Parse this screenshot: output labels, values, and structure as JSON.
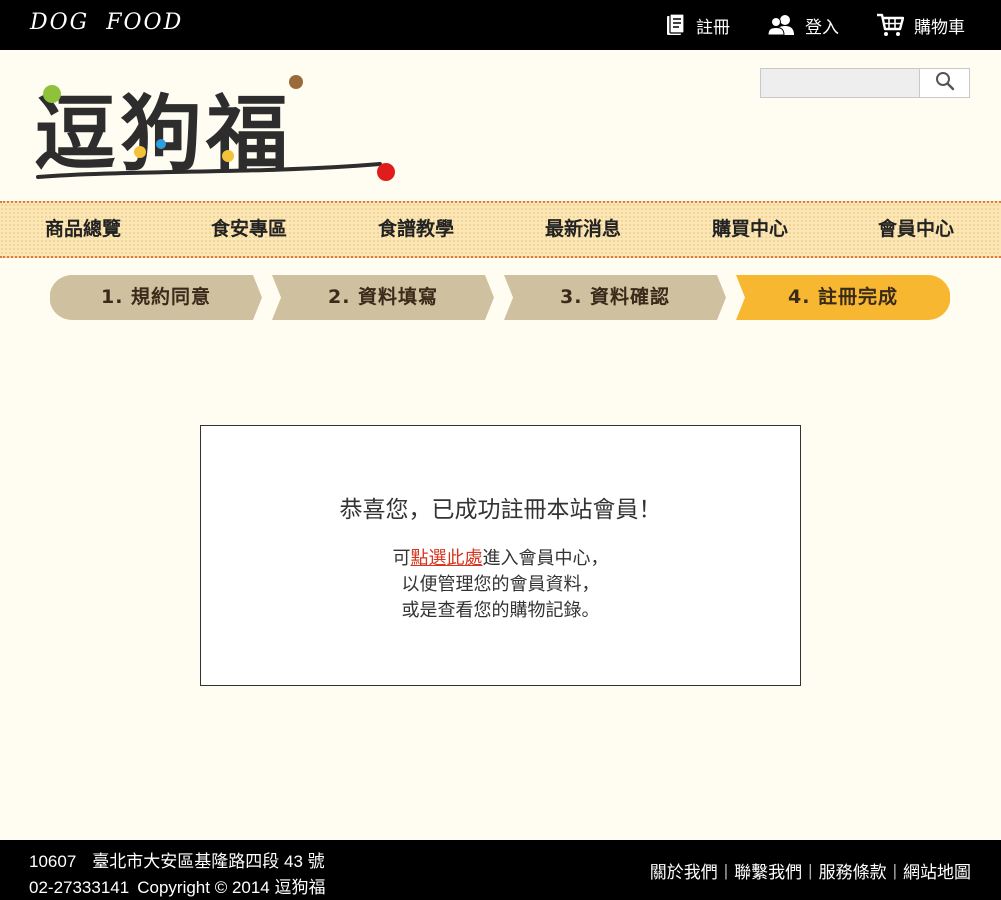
{
  "brand": "DOG  FOOD",
  "top_links": {
    "register": "註冊",
    "login": "登入",
    "cart": "購物車"
  },
  "logo": {
    "text": "逗狗福",
    "colors": [
      "#8fc23a",
      "#f2c23a",
      "#2f9de0",
      "#9b6a3a",
      "#e01c1c"
    ]
  },
  "search": {
    "placeholder": "",
    "value": ""
  },
  "nav": [
    "商品總覽",
    "食安專區",
    "食譜教學",
    "最新消息",
    "購買中心",
    "會員中心"
  ],
  "steps": [
    {
      "label": "1.  規約同意",
      "active": false
    },
    {
      "label": "2.  資料填寫",
      "active": false
    },
    {
      "label": "3.  資料確認",
      "active": false
    },
    {
      "label": "4.  註冊完成",
      "active": true
    }
  ],
  "step_colors": {
    "inactive": "#cfc19f",
    "active": "#f7b731"
  },
  "message": {
    "title": "恭喜您，已成功註冊本站會員！",
    "line1_prefix": "可",
    "line1_link": "點選此處",
    "line1_suffix": "進入會員中心，",
    "line2": "以便管理您的會員資料，",
    "line3": "或是查看您的購物記錄。"
  },
  "footer": {
    "zip": "10607",
    "address": "臺北市大安區基隆路四段 43 號",
    "phone": "02-27333141",
    "copyright": "Copyright © 2014 逗狗福",
    "links": [
      "關於我們",
      "聯繫我們",
      "服務條款",
      "網站地圖"
    ]
  }
}
